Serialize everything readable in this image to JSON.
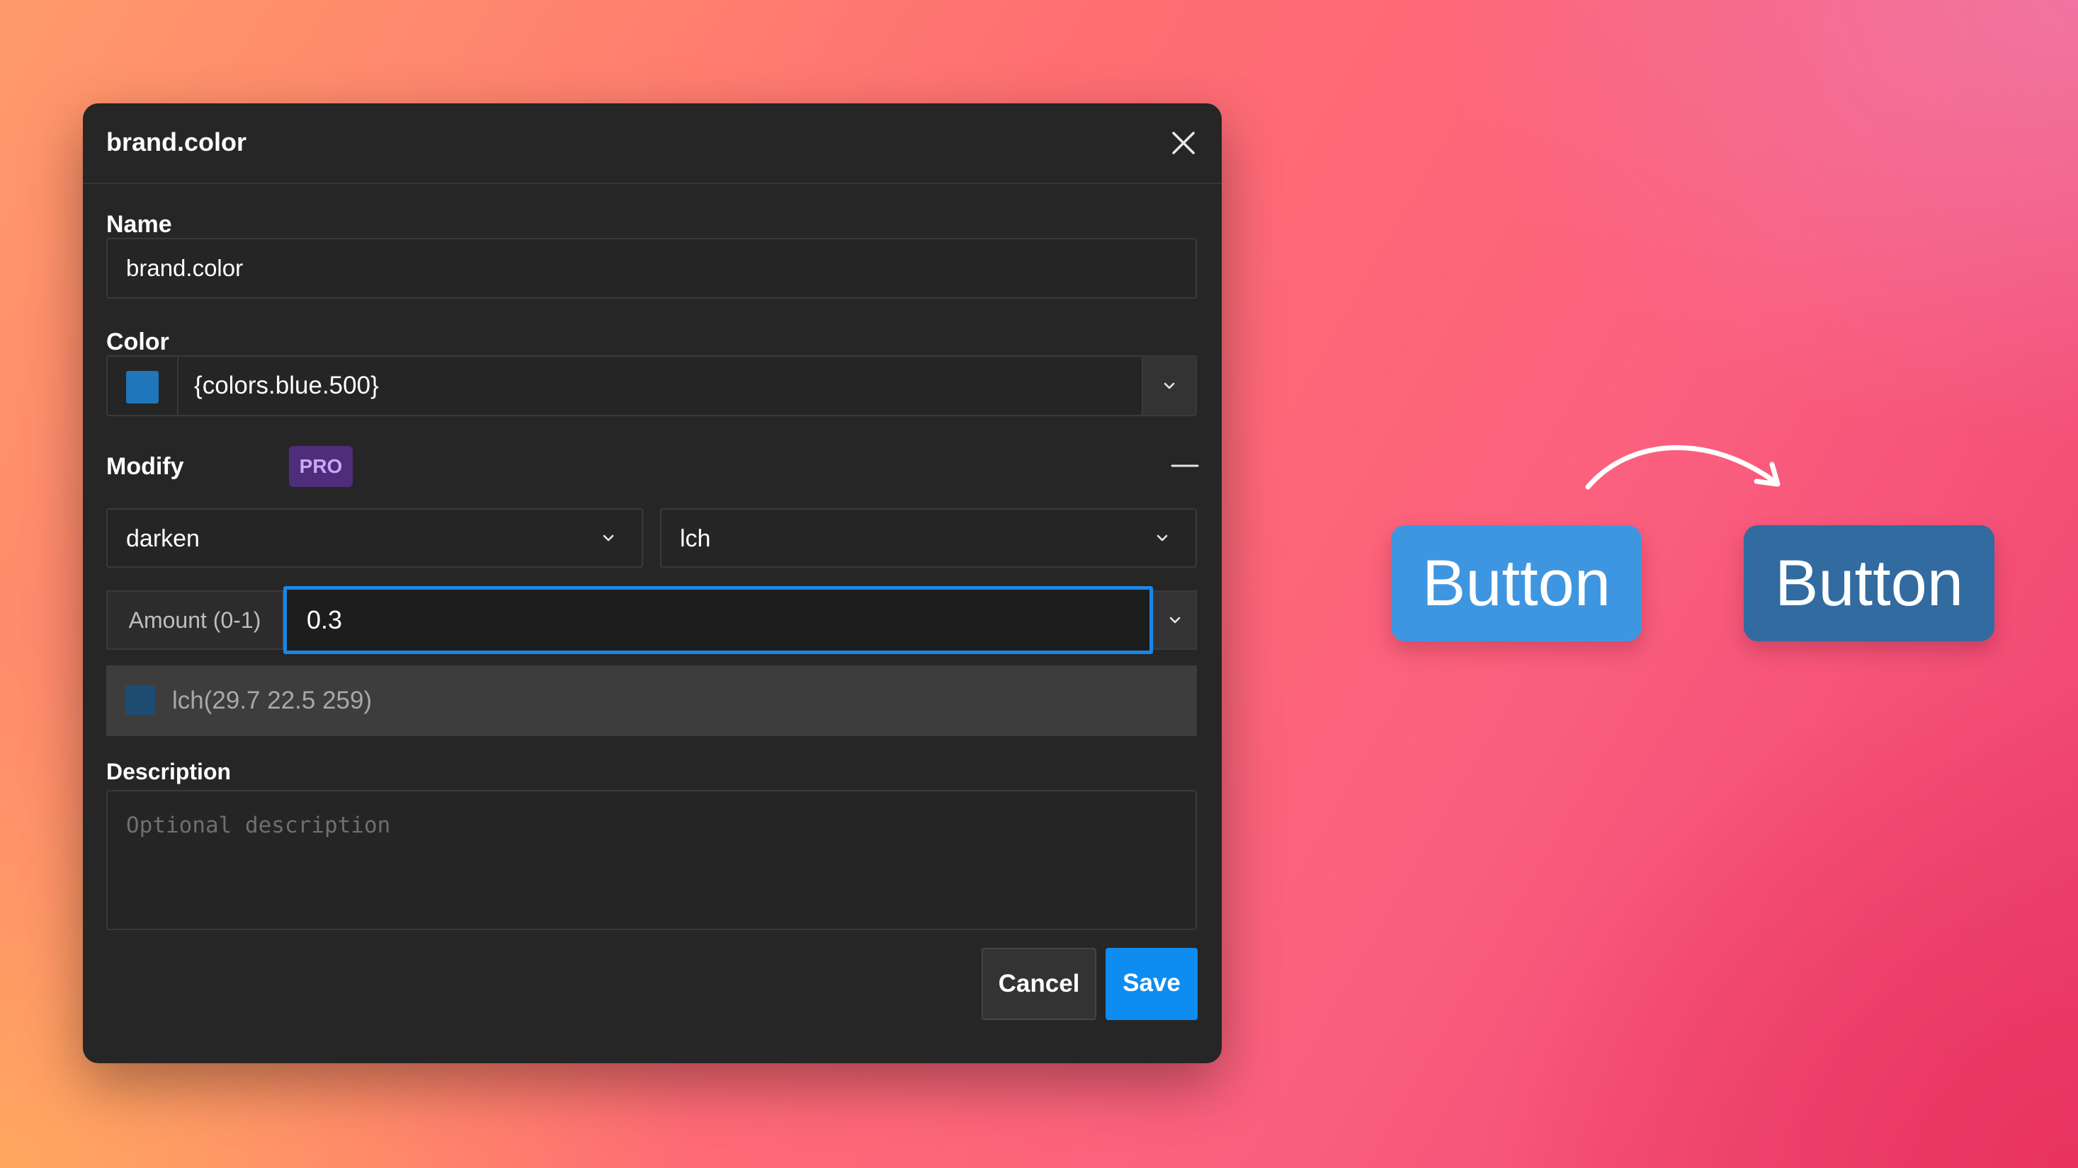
{
  "dialog": {
    "title": "brand.color",
    "name_label": "Name",
    "name_value": "brand.color",
    "color_label": "Color",
    "color_value": "{colors.blue.500}",
    "color_swatch": "#1f76ba",
    "modify_label": "Modify",
    "pro_badge": "PRO",
    "modifier_type": "darken",
    "color_space": "lch",
    "amount_label": "Amount (0-1)",
    "amount_value": "0.3",
    "result_value": "lch(29.7 22.5 259)",
    "result_swatch": "#1e4c73",
    "description_label": "Description",
    "description_placeholder": "Optional description",
    "cancel_label": "Cancel",
    "save_label": "Save"
  },
  "preview": {
    "before_label": "Button",
    "after_label": "Button",
    "before_color": "#3f96e0",
    "after_color": "#316ba0"
  },
  "colors": {
    "accent": "#0e8cf0",
    "pro_badge_bg": "#4e2d7a",
    "pro_badge_text": "#c9a7ff"
  }
}
